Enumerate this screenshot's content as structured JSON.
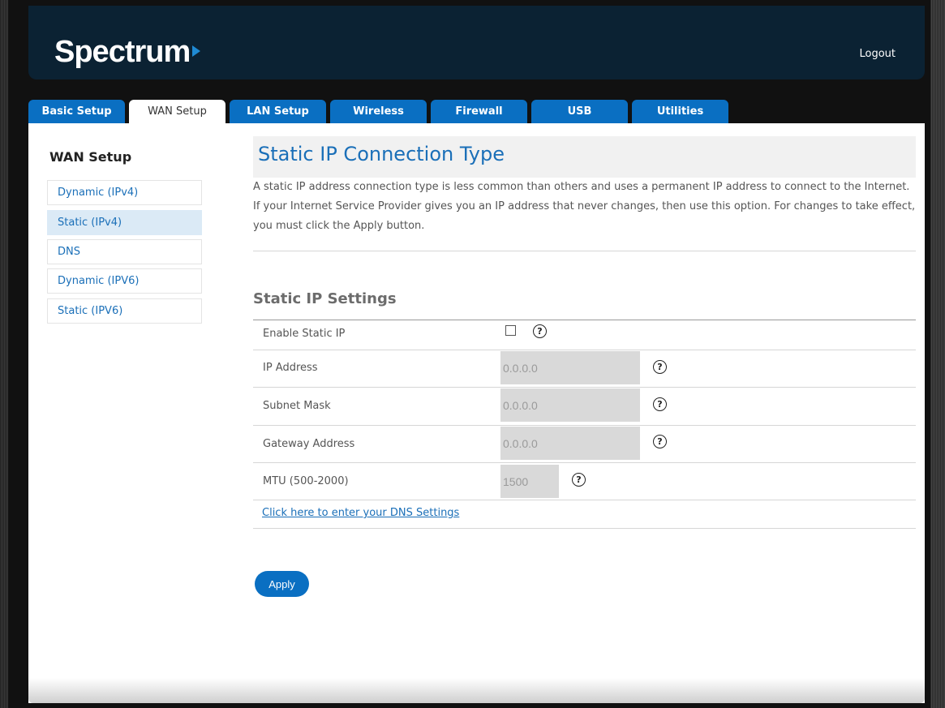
{
  "header": {
    "logo_text": "Spectrum",
    "logout_label": "Logout"
  },
  "tabs": [
    {
      "label": "Basic Setup",
      "active": false
    },
    {
      "label": "WAN Setup",
      "active": true
    },
    {
      "label": "LAN Setup",
      "active": false
    },
    {
      "label": "Wireless",
      "active": false
    },
    {
      "label": "Firewall",
      "active": false
    },
    {
      "label": "USB",
      "active": false
    },
    {
      "label": "Utilities",
      "active": false
    }
  ],
  "sidebar": {
    "title": "WAN Setup",
    "items": [
      {
        "label": "Dynamic (IPv4)",
        "active": false
      },
      {
        "label": "Static (IPv4)",
        "active": true
      },
      {
        "label": "DNS",
        "active": false
      },
      {
        "label": "Dynamic (IPV6)",
        "active": false
      },
      {
        "label": "Static (IPV6)",
        "active": false
      }
    ]
  },
  "main": {
    "page_title": "Static IP Connection Type",
    "intro_text": "A static IP address connection type is less common than others and uses a permanent IP address to connect to the Internet. If your Internet Service Provider gives you an IP address that never changes, then use this option. For changes to take effect, you must click the Apply button.",
    "section_title": "Static IP Settings",
    "enable_label": "Enable Static IP",
    "enable_checked": false,
    "fields": [
      {
        "label": "IP Address",
        "value": "0.0.0.0"
      },
      {
        "label": "Subnet Mask",
        "value": "0.0.0.0"
      },
      {
        "label": "Gateway Address",
        "value": "0.0.0.0"
      },
      {
        "label": "MTU (500-2000)",
        "value": "1500"
      }
    ],
    "help_icon_glyph": "?",
    "dns_link_text": "Click here to enter your DNS Settings",
    "apply_label": "Apply"
  },
  "colors": {
    "accent": "#0a6fc2",
    "header_bg": "#0b2233",
    "link": "#1a6fb8"
  }
}
